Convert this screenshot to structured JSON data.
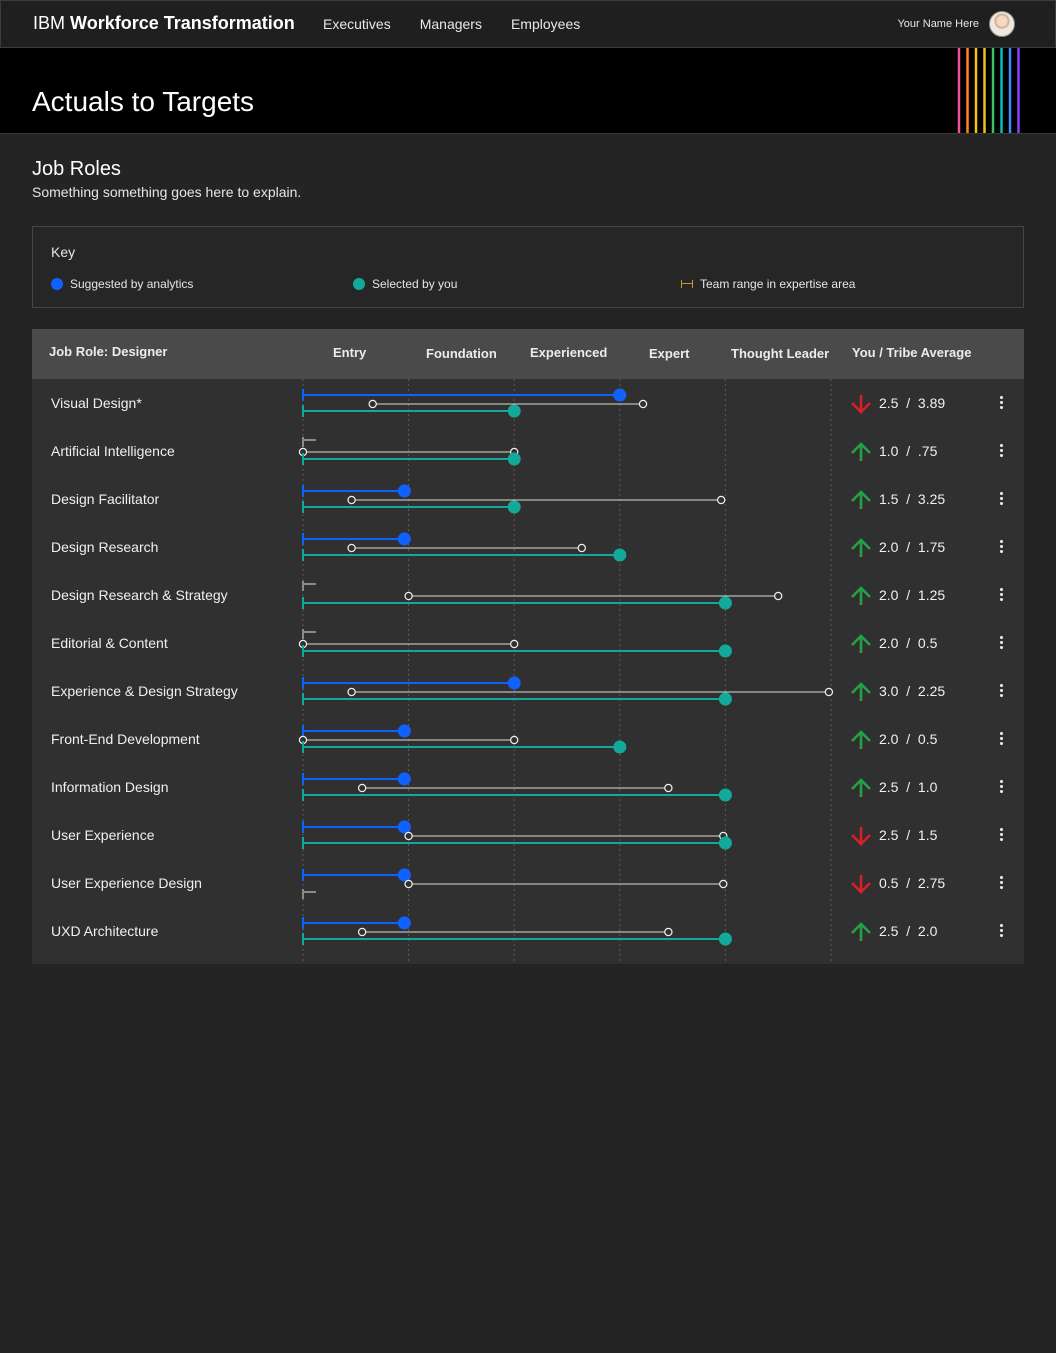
{
  "nav": {
    "brand_prefix": "IBM",
    "brand_name": "Workforce Transformation",
    "links": [
      "Executives",
      "Managers",
      "Employees"
    ],
    "user_name": "Your Name Here"
  },
  "header": {
    "title": "Actuals to Targets"
  },
  "section": {
    "title": "Job Roles",
    "subtitle": "Something something goes here to explain."
  },
  "key": {
    "title": "Key",
    "items": [
      {
        "label": "Suggested by analytics",
        "color": "#0f62fe"
      },
      {
        "label": "Selected by you",
        "color": "#12a99a"
      },
      {
        "label": "Team range in expertise area",
        "color": "#c79a2c"
      }
    ]
  },
  "table": {
    "headers": {
      "role": "Job Role: Designer",
      "levels": [
        "Entry",
        "Foundation",
        "Experienced",
        "Expert",
        "Thought Leader"
      ],
      "avg": "You / Tribe Average"
    },
    "rows": [
      {
        "label": "Visual Design*",
        "trend": "down",
        "you": "2.5",
        "avg": "3.89",
        "suggested": 3.0,
        "selected": 2.0,
        "range": [
          0.66,
          3.22
        ]
      },
      {
        "label": "Artificial Intelligence",
        "trend": "up",
        "you": "1.0",
        "avg": ".75",
        "suggested": null,
        "selected": 2.0,
        "range": [
          0,
          2.0
        ]
      },
      {
        "label": "Design Facilitator",
        "trend": "up",
        "you": "1.5",
        "avg": "3.25",
        "suggested": 0.96,
        "selected": 2.0,
        "range": [
          0.46,
          3.96
        ]
      },
      {
        "label": "Design Research",
        "trend": "up",
        "you": "2.0",
        "avg": "1.75",
        "suggested": 0.96,
        "selected": 3.0,
        "range": [
          0.46,
          2.64
        ]
      },
      {
        "label": "Design Research & Strategy",
        "trend": "up",
        "you": "2.0",
        "avg": "1.25",
        "suggested": null,
        "selected": 4.0,
        "range": [
          1.0,
          4.5
        ]
      },
      {
        "label": "Editorial & Content",
        "trend": "up",
        "you": "2.0",
        "avg": "0.5",
        "suggested": null,
        "selected": 4.0,
        "range": [
          0,
          2.0
        ]
      },
      {
        "label": "Experience & Design Strategy",
        "trend": "up",
        "you": "3.0",
        "avg": "2.25",
        "suggested": 2.0,
        "selected": 4.0,
        "range": [
          0.46,
          4.98
        ]
      },
      {
        "label": "Front-End Development",
        "trend": "up",
        "you": "2.0",
        "avg": "0.5",
        "suggested": 0.96,
        "selected": 3.0,
        "range": [
          0,
          2.0
        ]
      },
      {
        "label": "Information Design",
        "trend": "up",
        "you": "2.5",
        "avg": "1.0",
        "suggested": 0.96,
        "selected": 4.0,
        "range": [
          0.56,
          3.46
        ]
      },
      {
        "label": "User Experience",
        "trend": "down",
        "you": "2.5",
        "avg": "1.5",
        "suggested": 0.96,
        "selected": 4.0,
        "range": [
          1.0,
          3.98
        ]
      },
      {
        "label": "User Experience Design",
        "trend": "down",
        "you": "0.5",
        "avg": "2.75",
        "suggested": 0.96,
        "selected": null,
        "range": [
          1.0,
          3.98
        ]
      },
      {
        "label": "UXD Architecture",
        "trend": "up",
        "you": "2.5",
        "avg": "2.0",
        "suggested": 0.96,
        "selected": 4.0,
        "range": [
          0.56,
          3.46
        ]
      }
    ]
  },
  "colors": {
    "suggested": "#0f62fe",
    "selected": "#12a99a",
    "up": "#24a148",
    "down": "#da1e28",
    "stripes": [
      "#ee5396",
      "#ff832b",
      "#f1c21b",
      "#f1c21b",
      "#42be65",
      "#08bdba",
      "#4589ff",
      "#8a3ffc"
    ]
  }
}
